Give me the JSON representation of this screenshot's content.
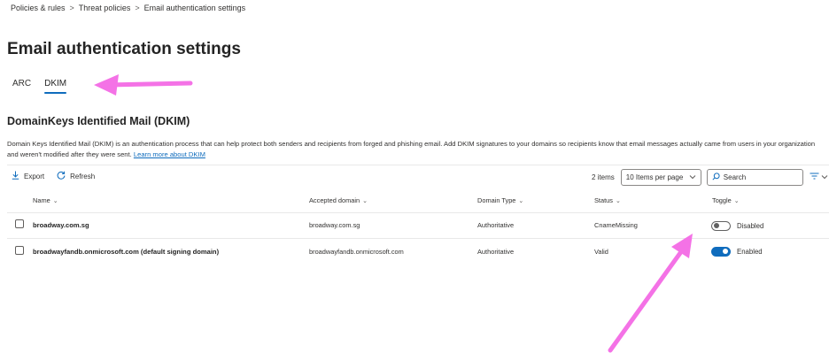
{
  "breadcrumb": [
    "Policies & rules",
    "Threat policies",
    "Email authentication settings"
  ],
  "page_title": "Email authentication settings",
  "tabs": [
    {
      "label": "ARC",
      "active": false
    },
    {
      "label": "DKIM",
      "active": true
    }
  ],
  "section": {
    "title": "DomainKeys Identified Mail (DKIM)",
    "description": "Domain Keys Identified Mail (DKIM) is an authentication process that can help protect both senders and recipients from forged and phishing email. Add DKIM signatures to your domains so recipients know that email messages actually came from users in your organization and weren't modified after they were sent.",
    "learn_more": "Learn more about DKIM"
  },
  "toolbar": {
    "export_label": "Export",
    "refresh_label": "Refresh",
    "items_count": "2 items",
    "per_page": "10 Items per page",
    "search_placeholder": "Search"
  },
  "table": {
    "columns": [
      "Name",
      "Accepted domain",
      "Domain Type",
      "Status",
      "Toggle"
    ],
    "rows": [
      {
        "name": "broadway.com.sg",
        "accepted_domain": "broadway.com.sg",
        "domain_type": "Authoritative",
        "status": "CnameMissing",
        "toggle_on": false,
        "toggle_label": "Disabled"
      },
      {
        "name": "broadwayfandb.onmicrosoft.com (default signing domain)",
        "accepted_domain": "broadwayfandb.onmicrosoft.com",
        "domain_type": "Authoritative",
        "status": "Valid",
        "toggle_on": true,
        "toggle_label": "Enabled"
      }
    ]
  },
  "colors": {
    "accent": "#0f6cbd",
    "annotation_arrow": "#f472e6"
  }
}
